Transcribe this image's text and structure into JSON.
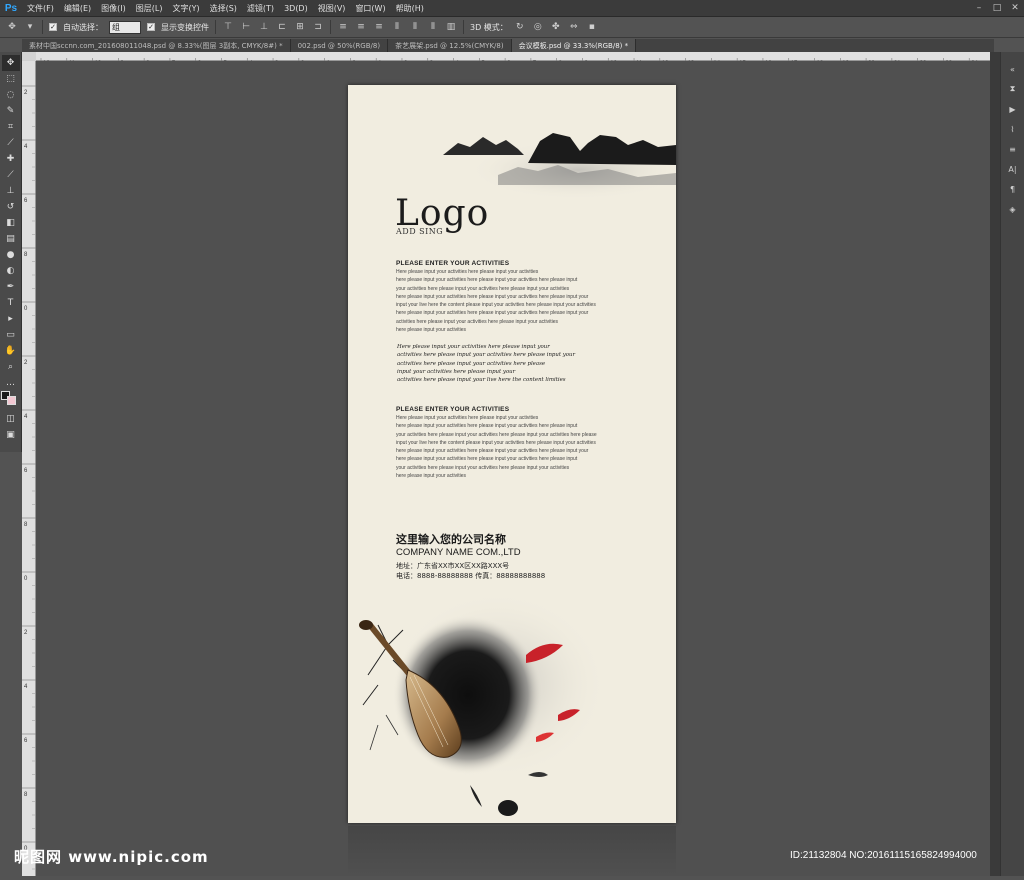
{
  "app": {
    "logo": "Ps",
    "menu": [
      "文件(F)",
      "编辑(E)",
      "图像(I)",
      "图层(L)",
      "文字(Y)",
      "选择(S)",
      "滤镜(T)",
      "3D(D)",
      "视图(V)",
      "窗口(W)",
      "帮助(H)"
    ],
    "window_controls": [
      "–",
      "□",
      "✕"
    ]
  },
  "options": {
    "auto_select_label": "自动选择：",
    "auto_select_value": "组",
    "show_transform_label": "显示变换控件",
    "mode_3d_label": "3D 模式："
  },
  "tabs": [
    {
      "label": "素材中国sccnn.com_201608011048.psd @ 8.33%(图层 3副本, CMYK/8#) *",
      "active": false
    },
    {
      "label": "002.psd @ 50%(RGB/8)",
      "active": false
    },
    {
      "label": "茶艺展架.psd @ 12.5%(CMYK/8)",
      "active": false
    },
    {
      "label": "会议模板.psd @ 33.3%(RGB/8) *",
      "active": true
    }
  ],
  "rulers": {
    "top": [
      "12",
      "11",
      "10",
      "9",
      "8",
      "7",
      "6",
      "5",
      "4",
      "3",
      "2",
      "1",
      "0",
      "1",
      "2",
      "3",
      "4",
      "5",
      "6",
      "7",
      "8",
      "9",
      "10",
      "11",
      "12",
      "13",
      "14",
      "15",
      "16",
      "17",
      "18",
      "19",
      "20",
      "21",
      "22",
      "23",
      "24"
    ],
    "left": [
      "2",
      "4",
      "6",
      "8",
      "0",
      "2",
      "4",
      "6",
      "8",
      "0",
      "2",
      "4",
      "6",
      "8",
      "0"
    ]
  },
  "tools": [
    "move-icon",
    "marquee-icon",
    "lasso-icon",
    "quick-select-icon",
    "crop-icon",
    "eyedropper-icon",
    "healing-icon",
    "brush-icon",
    "stamp-icon",
    "history-brush-icon",
    "eraser-icon",
    "gradient-icon",
    "blur-icon",
    "dodge-icon",
    "pen-icon",
    "type-icon",
    "path-select-icon",
    "shape-icon",
    "hand-icon",
    "zoom-icon"
  ],
  "poster": {
    "logo": "Logo",
    "logo_sub": "ADD SING",
    "heading1": "PLEASE ENTER YOUR ACTIVITIES",
    "para1": [
      "Here please input your activities here please input your activities",
      "here please input your activities here please input your activities here please input",
      "your activities here please input your activities here please input your activities",
      "here please input your activities here please input your activities here please input your",
      "input your live here the content please input your activities here please input your activities",
      "here please input your activities here please input your activities here please input your",
      " activities here please input your activities here please input your activities",
      "here please input your activities"
    ],
    "script": [
      "Here please input your activities here please input your",
      "activities here please input your activities here please input your",
      "activities here please input your activities here please",
      "input your activities here please input your",
      "activities here please input your live here the content limities"
    ],
    "heading2": "PLEASE ENTER YOUR ACTIVITIES",
    "para2": [
      "Here please input your activities here please input your activities",
      "here please input your activities here please input your activities here please input",
      "your activities here please input your activities here please input your activities here please",
      "input your live here the content please input your activities here please input your activities",
      "here please input your activities here please input your activities here please input your",
      "here please input your activities here please input your activities here please input",
      "your activities here please input your activities here please input your activities",
      "here please input your activities"
    ],
    "company_cn": "这里输入您的公司名称",
    "company_en": "COMPANY NAME COM.,LTD",
    "address": "地址：广东省XX市XX区XX路XXX号",
    "phone": "电话：8888-88888888  传真：88888888888"
  },
  "watermark": {
    "left": "昵图网 www.nipic.com",
    "right": "ID:21132804 NO:20161115165824994000"
  },
  "colors": {
    "ps_blue": "#31a8ff",
    "paper": "#f1ede0",
    "ink": "#1a1a1a",
    "petal_red": "#c8222a"
  }
}
